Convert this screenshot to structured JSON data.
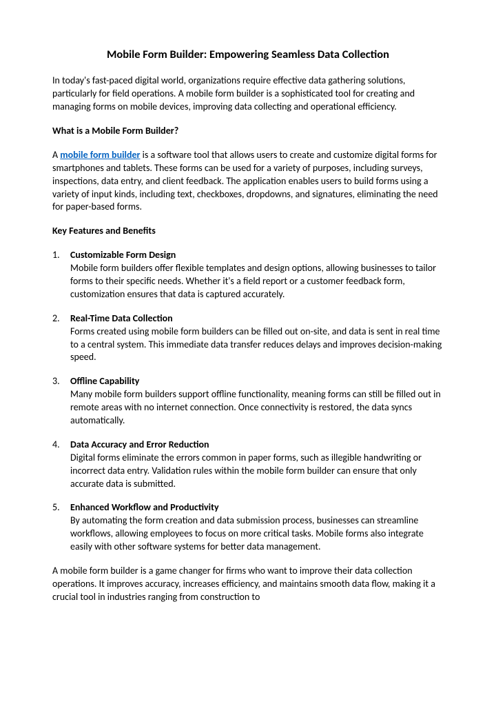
{
  "title": "Mobile Form Builder: Empowering Seamless Data Collection",
  "intro": "In today's fast-paced digital world, organizations require effective data gathering solutions, particularly for field operations. A mobile form builder is a sophisticated tool for creating and managing forms on mobile devices, improving data collecting and operational efficiency.",
  "section1_heading": "What is a Mobile Form Builder?",
  "section1_pre": "A ",
  "section1_link": "mobile form builder",
  "section1_post": " is a software tool that allows users to create and customize digital forms for smartphones and tablets. These forms can be used for a variety of purposes, including surveys, inspections, data entry, and client feedback. The application enables users to build forms using a variety of input kinds, including text, checkboxes, dropdowns, and signatures, eliminating the need for paper-based forms.",
  "section2_heading": "Key Features and Benefits",
  "features": [
    {
      "num": "1.",
      "title": "Customizable Form Design",
      "body": "Mobile form builders offer flexible templates and design options, allowing businesses to tailor forms to their specific needs. Whether it's a field report or a customer feedback form, customization ensures that data is captured accurately."
    },
    {
      "num": "2.",
      "title": "Real-Time Data Collection",
      "body": "Forms created using mobile form builders can be filled out on-site, and data is sent in real time to a central system. This immediate data transfer reduces delays and improves decision-making speed."
    },
    {
      "num": "3.",
      "title": "Offline Capability",
      "body": "Many mobile form builders support offline functionality, meaning forms can still be filled out in remote areas with no internet connection. Once connectivity is restored, the data syncs automatically."
    },
    {
      "num": "4.",
      "title": "Data Accuracy and Error Reduction",
      "body": "Digital forms eliminate the errors common in paper forms, such as illegible handwriting or incorrect data entry. Validation rules within the mobile form builder can ensure that only accurate data is submitted."
    },
    {
      "num": "5.",
      "title": "Enhanced Workflow and Productivity",
      "body": "By automating the form creation and data submission process, businesses can streamline workflows, allowing employees to focus on more critical tasks. Mobile forms also integrate easily with other software systems for better data management."
    }
  ],
  "conclusion": "A mobile form builder is a game changer for firms who want to improve their data collection operations. It improves accuracy, increases efficiency, and maintains smooth data flow, making it a crucial tool in industries ranging from construction to"
}
